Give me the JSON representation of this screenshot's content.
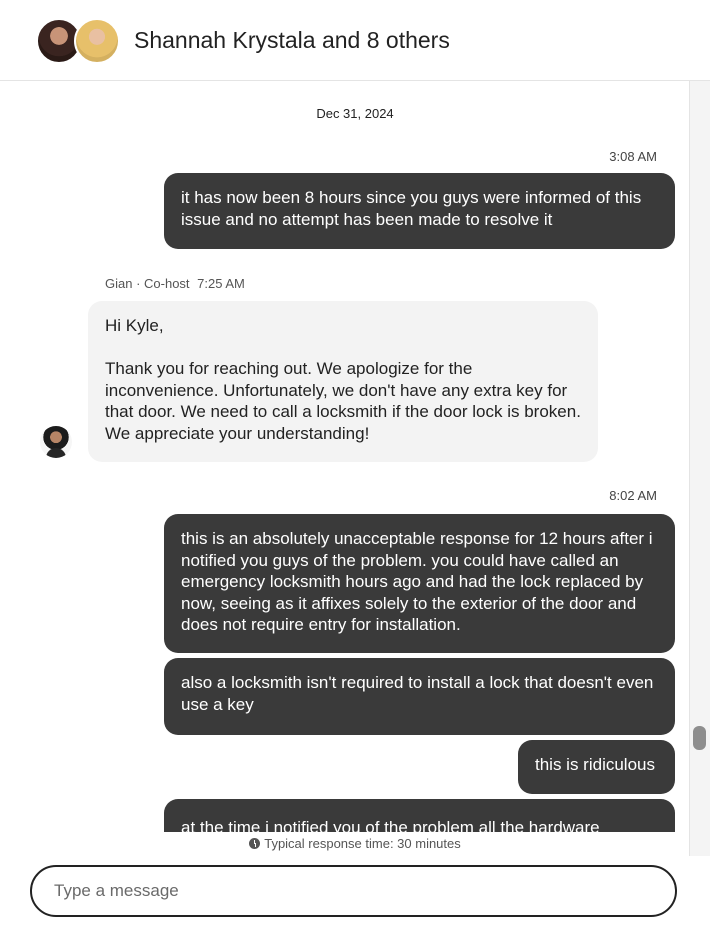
{
  "header": {
    "title": "Shannah Krystala and 8 others"
  },
  "thread": {
    "date_divider": "Dec 31, 2024",
    "messages": [
      {
        "time": "3:08 AM",
        "text": "it has now been 8 hours since you guys were informed of this issue and no attempt has been made to resolve it"
      },
      {
        "sender": "Gian · Co-host",
        "time": "7:25 AM",
        "text": "Hi Kyle,\n\nThank you for reaching out. We apologize for the inconvenience. Unfortunately, we don't have any extra key for that door. We need to call a locksmith if the door lock is broken. We appreciate your understanding!"
      },
      {
        "time": "8:02 AM",
        "text": "this is an absolutely unacceptable response for 12 hours after i notified you guys of the problem. you could have called an emergency locksmith hours ago and had the lock replaced by now, seeing as it affixes solely to the exterior of the door and does not require entry for installation."
      },
      {
        "text": "also a locksmith isn't required to install a lock that doesn't even use a key"
      },
      {
        "text": "this is ridiculous"
      },
      {
        "text": "at the time i notified you of the problem all the hardware"
      }
    ]
  },
  "footer": {
    "response_time": "Typical response time: 30 minutes",
    "composer_placeholder": "Type a message"
  },
  "icons": {
    "clock": "clock-icon"
  }
}
